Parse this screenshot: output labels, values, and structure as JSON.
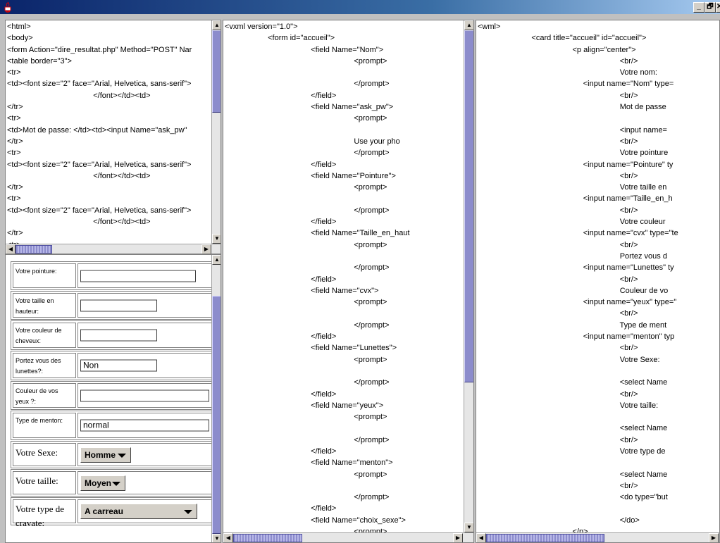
{
  "window": {
    "min_label": "_",
    "max_label": "🗗",
    "close_label": "✕"
  },
  "html_source": {
    "lines": [
      "<html>",
      "<body>",
      "<form Action=\"dire_resultat.php\" Method=\"POST\" Nar",
      "<table border=\"3\">",
      "<tr>",
      "<td><font size=\"2\" face=\"Arial, Helvetica, sans-serif\">",
      "                                        </font></td><td>",
      "</tr>",
      "<tr>",
      "<td>Mot de passe: </td><td><input Name=\"ask_pw\"",
      "</tr>",
      "<tr>",
      "<td><font size=\"2\" face=\"Arial, Helvetica, sans-serif\">",
      "                                        </font></td><td>",
      "</tr>",
      "<tr>",
      "<td><font size=\"2\" face=\"Arial, Helvetica, sans-serif\">",
      "                                        </font></td><td>",
      "</tr>",
      "<tr>"
    ]
  },
  "vxml_source": {
    "lines": [
      "<vxml version=\"1.0\">",
      "                    <form id=\"accueil\">",
      "                                        <field Name=\"Nom\">",
      "                                                            <prompt>",
      "",
      "                                                            </prompt>",
      "                                        </field>",
      "                                        <field Name=\"ask_pw\">",
      "                                                            <prompt>",
      "",
      "                                                            Use your pho",
      "                                                            </prompt>",
      "                                        </field>",
      "                                        <field Name=\"Pointure\">",
      "                                                            <prompt>",
      "",
      "                                                            </prompt>",
      "                                        </field>",
      "                                        <field Name=\"Taille_en_haut",
      "                                                            <prompt>",
      "",
      "                                                            </prompt>",
      "                                        </field>",
      "                                        <field Name=\"cvx\">",
      "                                                            <prompt>",
      "",
      "                                                            </prompt>",
      "                                        </field>",
      "                                        <field Name=\"Lunettes\">",
      "                                                            <prompt>",
      "",
      "                                                            </prompt>",
      "                                        </field>",
      "                                        <field Name=\"yeux\">",
      "                                                            <prompt>",
      "",
      "                                                            </prompt>",
      "                                        </field>",
      "                                        <field Name=\"menton\">",
      "                                                            <prompt>",
      "",
      "                                                            </prompt>",
      "                                        </field>",
      "                                        <field Name=\"choix_sexe\">",
      "                                                            <prompt>"
    ]
  },
  "wml_source": {
    "lines": [
      "<wml>",
      "                         <card title=\"accueil\" id=\"accueil\">",
      "                                            <p align=\"center\">",
      "                                                                  <br/>",
      "                                                                  Votre nom:",
      "                                                 <input name=\"Nom\" type=",
      "                                                                  <br/>",
      "                                                                  Mot de passe",
      "",
      "                                                                  <input name=",
      "                                                                  <br/>",
      "                                                                  Votre pointure",
      "                                                 <input name=\"Pointure\" ty",
      "                                                                  <br/>",
      "                                                                  Votre taille en",
      "                                                 <input name=\"Taille_en_h",
      "                                                                  <br/>",
      "                                                                  Votre couleur",
      "                                                 <input name=\"cvx\" type=\"te",
      "                                                                  <br/>",
      "                                                                  Portez vous d",
      "                                                 <input name=\"Lunettes\" ty",
      "                                                                  <br/>",
      "                                                                  Couleur de vo",
      "                                                 <input name=\"yeux\" type=\"",
      "                                                                  <br/>",
      "                                                                  Type de ment",
      "                                                 <input name=\"menton\" typ",
      "                                                                  <br/>",
      "                                                                  Votre Sexe:",
      "",
      "                                                                  <select Name",
      "                                                                  <br/>",
      "                                                                  Votre taille:",
      "",
      "                                                                  <select Name",
      "                                                                  <br/>",
      "                                                                  Votre type de",
      "",
      "                                                                  <select Name",
      "                                                                  <br/>",
      "                                                                  <do type=\"but",
      "",
      "                                                                  </do>",
      "                                            </p>",
      "                      </card>"
    ]
  },
  "form": {
    "rows": [
      {
        "label": "Votre pointure:",
        "kind": "text",
        "value": "",
        "big": false
      },
      {
        "label": "Votre taille en hauteur:",
        "kind": "text",
        "value": "",
        "big": false
      },
      {
        "label": "Votre couleur de cheveux:",
        "kind": "text",
        "value": "",
        "big": false
      },
      {
        "label": "Portez vous des lunettes?:",
        "kind": "text",
        "value": "Non",
        "big": false
      },
      {
        "label": "Couleur de vos yeux ?:",
        "kind": "text",
        "value": "",
        "big": false
      },
      {
        "label": "Type de menton:",
        "kind": "text",
        "value": "normal",
        "big": false
      },
      {
        "label": "Votre Sexe:",
        "kind": "select",
        "value": "Homme",
        "big": true
      },
      {
        "label": "Votre taille:",
        "kind": "select",
        "value": "Moyen",
        "big": true
      },
      {
        "label": "Votre type de cravate:",
        "kind": "select",
        "value": "A carreau",
        "big": true
      }
    ]
  }
}
